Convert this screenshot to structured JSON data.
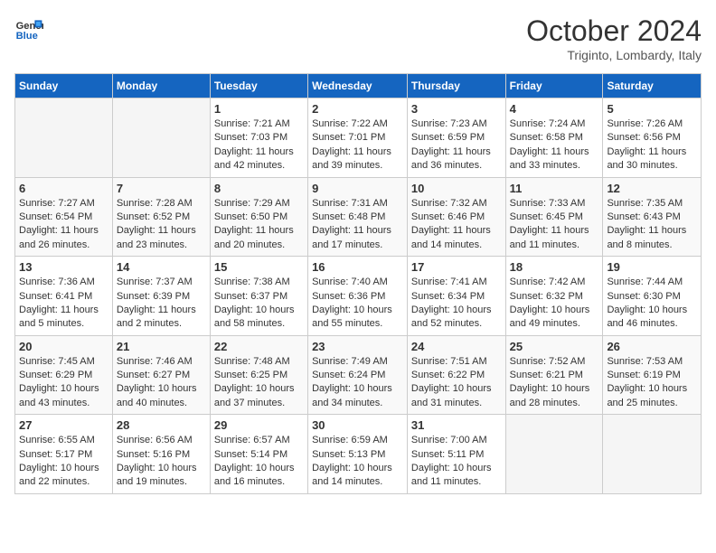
{
  "header": {
    "logo_general": "General",
    "logo_blue": "Blue",
    "month_title": "October 2024",
    "subtitle": "Triginto, Lombardy, Italy"
  },
  "days_of_week": [
    "Sunday",
    "Monday",
    "Tuesday",
    "Wednesday",
    "Thursday",
    "Friday",
    "Saturday"
  ],
  "weeks": [
    [
      {
        "day": "",
        "info": ""
      },
      {
        "day": "",
        "info": ""
      },
      {
        "day": "1",
        "sunrise": "Sunrise: 7:21 AM",
        "sunset": "Sunset: 7:03 PM",
        "daylight": "Daylight: 11 hours and 42 minutes."
      },
      {
        "day": "2",
        "sunrise": "Sunrise: 7:22 AM",
        "sunset": "Sunset: 7:01 PM",
        "daylight": "Daylight: 11 hours and 39 minutes."
      },
      {
        "day": "3",
        "sunrise": "Sunrise: 7:23 AM",
        "sunset": "Sunset: 6:59 PM",
        "daylight": "Daylight: 11 hours and 36 minutes."
      },
      {
        "day": "4",
        "sunrise": "Sunrise: 7:24 AM",
        "sunset": "Sunset: 6:58 PM",
        "daylight": "Daylight: 11 hours and 33 minutes."
      },
      {
        "day": "5",
        "sunrise": "Sunrise: 7:26 AM",
        "sunset": "Sunset: 6:56 PM",
        "daylight": "Daylight: 11 hours and 30 minutes."
      }
    ],
    [
      {
        "day": "6",
        "sunrise": "Sunrise: 7:27 AM",
        "sunset": "Sunset: 6:54 PM",
        "daylight": "Daylight: 11 hours and 26 minutes."
      },
      {
        "day": "7",
        "sunrise": "Sunrise: 7:28 AM",
        "sunset": "Sunset: 6:52 PM",
        "daylight": "Daylight: 11 hours and 23 minutes."
      },
      {
        "day": "8",
        "sunrise": "Sunrise: 7:29 AM",
        "sunset": "Sunset: 6:50 PM",
        "daylight": "Daylight: 11 hours and 20 minutes."
      },
      {
        "day": "9",
        "sunrise": "Sunrise: 7:31 AM",
        "sunset": "Sunset: 6:48 PM",
        "daylight": "Daylight: 11 hours and 17 minutes."
      },
      {
        "day": "10",
        "sunrise": "Sunrise: 7:32 AM",
        "sunset": "Sunset: 6:46 PM",
        "daylight": "Daylight: 11 hours and 14 minutes."
      },
      {
        "day": "11",
        "sunrise": "Sunrise: 7:33 AM",
        "sunset": "Sunset: 6:45 PM",
        "daylight": "Daylight: 11 hours and 11 minutes."
      },
      {
        "day": "12",
        "sunrise": "Sunrise: 7:35 AM",
        "sunset": "Sunset: 6:43 PM",
        "daylight": "Daylight: 11 hours and 8 minutes."
      }
    ],
    [
      {
        "day": "13",
        "sunrise": "Sunrise: 7:36 AM",
        "sunset": "Sunset: 6:41 PM",
        "daylight": "Daylight: 11 hours and 5 minutes."
      },
      {
        "day": "14",
        "sunrise": "Sunrise: 7:37 AM",
        "sunset": "Sunset: 6:39 PM",
        "daylight": "Daylight: 11 hours and 2 minutes."
      },
      {
        "day": "15",
        "sunrise": "Sunrise: 7:38 AM",
        "sunset": "Sunset: 6:37 PM",
        "daylight": "Daylight: 10 hours and 58 minutes."
      },
      {
        "day": "16",
        "sunrise": "Sunrise: 7:40 AM",
        "sunset": "Sunset: 6:36 PM",
        "daylight": "Daylight: 10 hours and 55 minutes."
      },
      {
        "day": "17",
        "sunrise": "Sunrise: 7:41 AM",
        "sunset": "Sunset: 6:34 PM",
        "daylight": "Daylight: 10 hours and 52 minutes."
      },
      {
        "day": "18",
        "sunrise": "Sunrise: 7:42 AM",
        "sunset": "Sunset: 6:32 PM",
        "daylight": "Daylight: 10 hours and 49 minutes."
      },
      {
        "day": "19",
        "sunrise": "Sunrise: 7:44 AM",
        "sunset": "Sunset: 6:30 PM",
        "daylight": "Daylight: 10 hours and 46 minutes."
      }
    ],
    [
      {
        "day": "20",
        "sunrise": "Sunrise: 7:45 AM",
        "sunset": "Sunset: 6:29 PM",
        "daylight": "Daylight: 10 hours and 43 minutes."
      },
      {
        "day": "21",
        "sunrise": "Sunrise: 7:46 AM",
        "sunset": "Sunset: 6:27 PM",
        "daylight": "Daylight: 10 hours and 40 minutes."
      },
      {
        "day": "22",
        "sunrise": "Sunrise: 7:48 AM",
        "sunset": "Sunset: 6:25 PM",
        "daylight": "Daylight: 10 hours and 37 minutes."
      },
      {
        "day": "23",
        "sunrise": "Sunrise: 7:49 AM",
        "sunset": "Sunset: 6:24 PM",
        "daylight": "Daylight: 10 hours and 34 minutes."
      },
      {
        "day": "24",
        "sunrise": "Sunrise: 7:51 AM",
        "sunset": "Sunset: 6:22 PM",
        "daylight": "Daylight: 10 hours and 31 minutes."
      },
      {
        "day": "25",
        "sunrise": "Sunrise: 7:52 AM",
        "sunset": "Sunset: 6:21 PM",
        "daylight": "Daylight: 10 hours and 28 minutes."
      },
      {
        "day": "26",
        "sunrise": "Sunrise: 7:53 AM",
        "sunset": "Sunset: 6:19 PM",
        "daylight": "Daylight: 10 hours and 25 minutes."
      }
    ],
    [
      {
        "day": "27",
        "sunrise": "Sunrise: 6:55 AM",
        "sunset": "Sunset: 5:17 PM",
        "daylight": "Daylight: 10 hours and 22 minutes."
      },
      {
        "day": "28",
        "sunrise": "Sunrise: 6:56 AM",
        "sunset": "Sunset: 5:16 PM",
        "daylight": "Daylight: 10 hours and 19 minutes."
      },
      {
        "day": "29",
        "sunrise": "Sunrise: 6:57 AM",
        "sunset": "Sunset: 5:14 PM",
        "daylight": "Daylight: 10 hours and 16 minutes."
      },
      {
        "day": "30",
        "sunrise": "Sunrise: 6:59 AM",
        "sunset": "Sunset: 5:13 PM",
        "daylight": "Daylight: 10 hours and 14 minutes."
      },
      {
        "day": "31",
        "sunrise": "Sunrise: 7:00 AM",
        "sunset": "Sunset: 5:11 PM",
        "daylight": "Daylight: 10 hours and 11 minutes."
      },
      {
        "day": "",
        "info": ""
      },
      {
        "day": "",
        "info": ""
      }
    ]
  ]
}
